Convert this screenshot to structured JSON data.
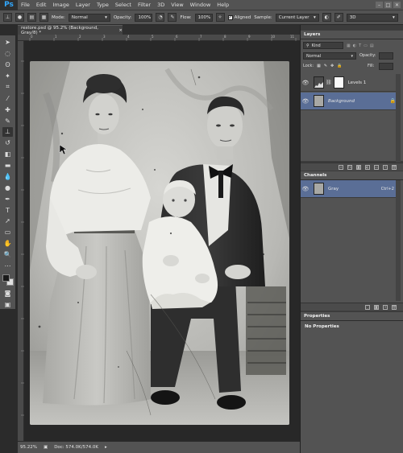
{
  "app": {
    "logo": "Ps"
  },
  "menu": [
    "File",
    "Edit",
    "Image",
    "Layer",
    "Type",
    "Select",
    "Filter",
    "3D",
    "View",
    "Window",
    "Help"
  ],
  "window_controls": [
    "–",
    "□",
    "✕"
  ],
  "options": {
    "mode_label": "Mode:",
    "mode_value": "Normal",
    "opacity_label": "Opacity:",
    "opacity_value": "100%",
    "flow_label": "Flow:",
    "flow_value": "100%",
    "aligned_label": "Aligned",
    "sample_label": "Sample:",
    "sample_value": "Current Layer",
    "workspace_value": "3D"
  },
  "document": {
    "tab_title": "restore.psd @ 95.2% (Background, Gray/8) *",
    "tab_close": "×"
  },
  "ruler_ticks": [
    "0",
    "1",
    "2",
    "3",
    "4",
    "5",
    "6",
    "7",
    "8",
    "9",
    "10",
    "11"
  ],
  "status": {
    "zoom": "95.22%",
    "doc_info": "Doc: 574.0K/574.0K"
  },
  "layers_panel": {
    "title": "Layers",
    "filter_value": "Kind",
    "blend_value": "Normal",
    "opacity_label": "Opacity:",
    "lock_label": "Lock:",
    "fill_label": "Fill:",
    "layers": [
      {
        "name": "Levels 1",
        "type": "adjustment"
      },
      {
        "name": "Background",
        "type": "image",
        "selected": true
      }
    ]
  },
  "channels_panel": {
    "title": "Channels",
    "channels": [
      {
        "name": "Gray",
        "shortcut": "Ctrl+2"
      }
    ]
  },
  "properties_panel": {
    "title": "Properties",
    "message": "No Properties"
  },
  "colors": {
    "ui_dark": "#535353",
    "selection_blue": "#5a6e96",
    "ps_blue": "#31a8ff"
  }
}
